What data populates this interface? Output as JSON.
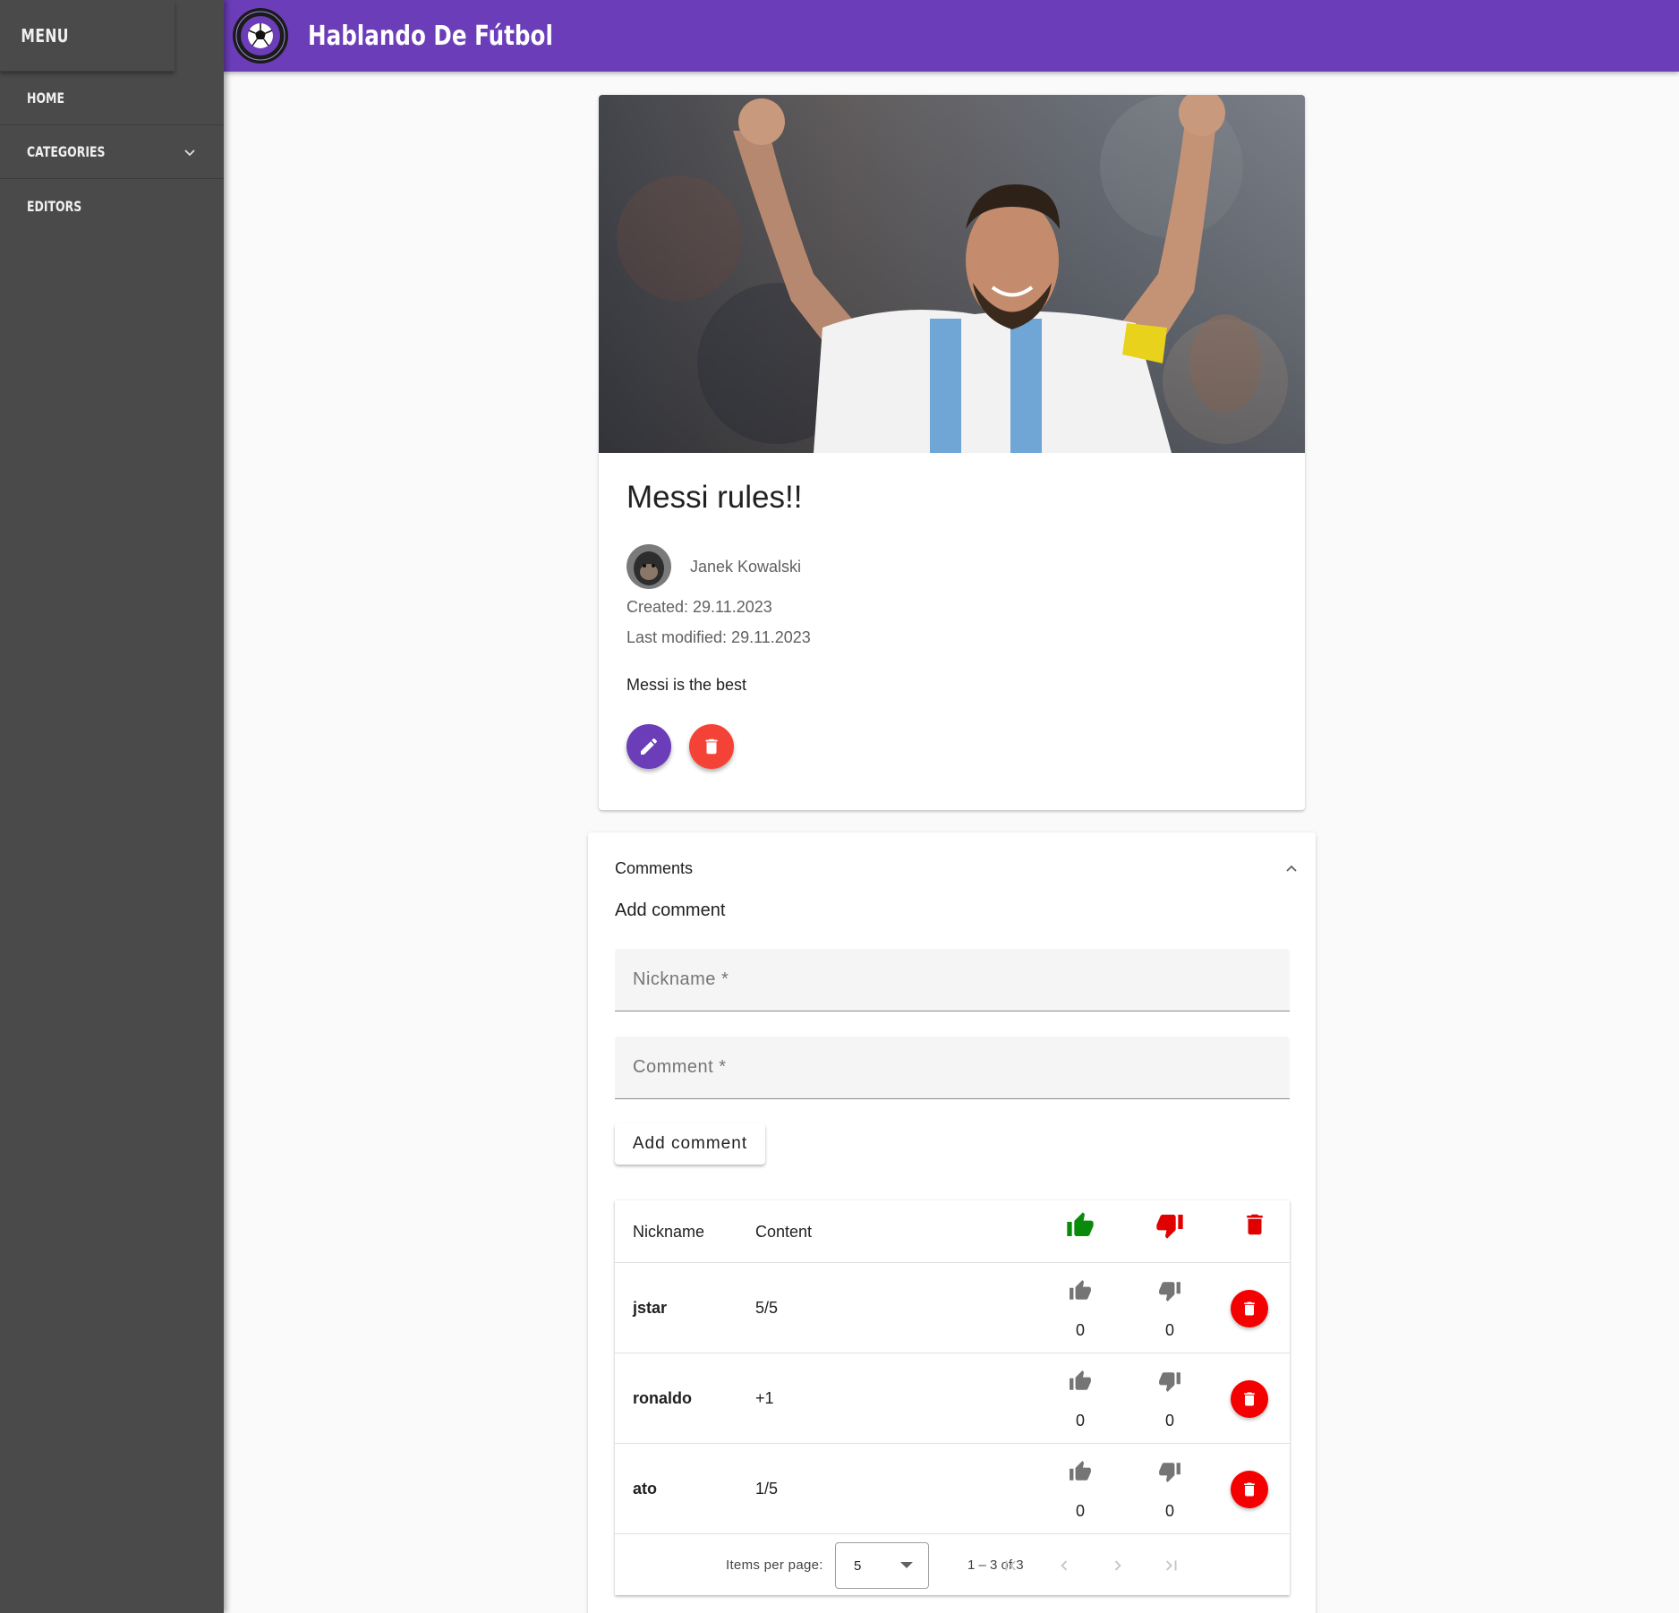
{
  "sidebar": {
    "menu_title": "MENU",
    "items": [
      {
        "label": "HOME"
      },
      {
        "label": "CATEGORIES"
      },
      {
        "label": "EDITORS"
      }
    ]
  },
  "header": {
    "title": "Hablando De Fútbol"
  },
  "article": {
    "title": "Messi rules!!",
    "author": "Janek Kowalski",
    "created": "Created: 29.11.2023",
    "modified": "Last modified: 29.11.2023",
    "content": "Messi is the best"
  },
  "comments": {
    "panel_title": "Comments",
    "add_heading": "Add comment",
    "nickname_placeholder": "Nickname *",
    "comment_placeholder": "Comment *",
    "add_button": "Add comment",
    "table": {
      "headers": {
        "nickname": "Nickname",
        "content": "Content"
      },
      "rows": [
        {
          "nickname": "jstar",
          "content": "5/5",
          "likes": "0",
          "dislikes": "0"
        },
        {
          "nickname": "ronaldo",
          "content": "+1",
          "likes": "0",
          "dislikes": "0"
        },
        {
          "nickname": "ato",
          "content": "1/5",
          "likes": "0",
          "dislikes": "0"
        }
      ]
    },
    "paginator": {
      "items_per_page_label": "Items per page:",
      "items_per_page": "5",
      "range": "1 – 3 of 3"
    }
  },
  "colors": {
    "primary": "#6b3db8",
    "sidebar": "#4a4a4a",
    "delete": "#f44336",
    "row_delete": "#f40000",
    "like_header": "#0a8a0a",
    "dislike_header": "#e00000"
  },
  "icons": [
    "logo-icon",
    "chevron-down-icon",
    "pencil-icon",
    "trash-icon",
    "chevron-up-icon",
    "thumb-up-icon",
    "thumb-down-icon",
    "first-page-icon",
    "prev-page-icon",
    "next-page-icon",
    "last-page-icon"
  ]
}
